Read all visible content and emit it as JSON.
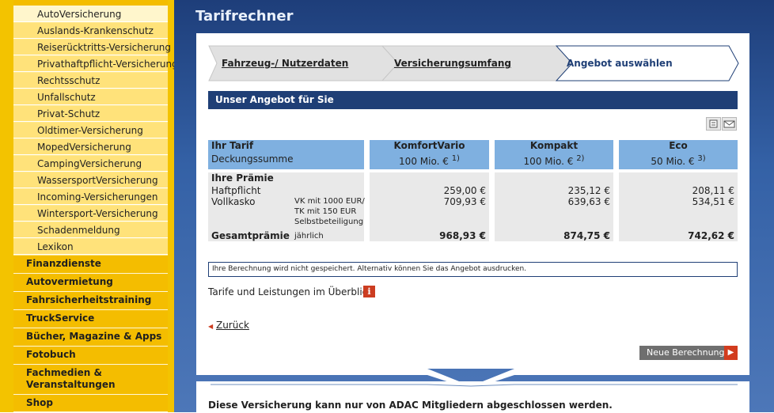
{
  "sidebar": {
    "sub_items": [
      {
        "label": "AutoVersicherung"
      },
      {
        "label": "Auslands-Krankenschutz"
      },
      {
        "label": "Reiserücktritts-Versicherung"
      },
      {
        "label": "Privathaftpflicht-Versicherung"
      },
      {
        "label": "Rechtsschutz"
      },
      {
        "label": "Unfallschutz"
      },
      {
        "label": "Privat-Schutz"
      },
      {
        "label": "Oldtimer-Versicherung"
      },
      {
        "label": "MopedVersicherung"
      },
      {
        "label": "CampingVersicherung"
      },
      {
        "label": "WassersportVersicherung"
      },
      {
        "label": "Incoming-Versicherungen"
      },
      {
        "label": "Wintersport-Versicherung"
      },
      {
        "label": "Schadenmeldung"
      },
      {
        "label": "Lexikon"
      }
    ],
    "main_items": [
      {
        "label": "Finanzdienste"
      },
      {
        "label": "Autovermietung"
      },
      {
        "label": "Fahrsicherheitstraining"
      },
      {
        "label": "TruckService"
      },
      {
        "label": "Bücher, Magazine & Apps"
      },
      {
        "label": "Fotobuch"
      },
      {
        "label": "Fachmedien & Veranstaltungen"
      },
      {
        "label": "Shop"
      }
    ]
  },
  "page": {
    "title": "Tarifrechner"
  },
  "steps": [
    {
      "label": "Fahrzeug-/ Nutzerdaten"
    },
    {
      "label": "Versicherungsumfang"
    },
    {
      "label": "Angebot auswählen"
    }
  ],
  "offer": {
    "heading": "Unser Angebot für Sie",
    "header": {
      "ihr_tarif": "Ihr Tarif",
      "deckungssumme": "Deckungssumme",
      "plans": [
        {
          "name": "KomfortVario",
          "coverage": "100 Mio. €",
          "footnote": "1)"
        },
        {
          "name": "Kompakt",
          "coverage": "100 Mio. €",
          "footnote": "2)"
        },
        {
          "name": "Eco",
          "coverage": "50 Mio. €",
          "footnote": "3)"
        }
      ]
    },
    "body": {
      "premium_title": "Ihre Prämie",
      "haftpflicht": "Haftpflicht",
      "vollkasko": "Vollkasko",
      "vk_note_1": "VK mit 1000 EUR/",
      "vk_note_2": "TK mit 150 EUR",
      "vk_note_3": "Selbstbeteiligung",
      "total_label": "Gesamtprämie",
      "total_period": "jährlich",
      "plans": [
        {
          "haftpflicht": "259,00 €",
          "vollkasko": "709,93 €",
          "total": "968,93 €"
        },
        {
          "haftpflicht": "235,12 €",
          "vollkasko": "639,63 €",
          "total": "874,75 €"
        },
        {
          "haftpflicht": "208,11 €",
          "vollkasko": "534,51 €",
          "total": "742,62 €"
        }
      ]
    },
    "note": "Ihre Berechnung wird nicht gespeichert. Alternativ können Sie das Angebot ausdrucken.",
    "overview_link": "Tarife und Leistungen im Überblick",
    "info_glyph": "i",
    "back_link": "Zurück",
    "new_calc_button": "Neue Berechnung"
  },
  "footer_text": "Diese Versicherung kann nur von ADAC Mitgliedern abgeschlossen werden.",
  "colors": {
    "accent": "#1f3f76",
    "table_header": "#7fb0e0",
    "sidebar": "#f3c300",
    "cta": "#d23c1e"
  }
}
